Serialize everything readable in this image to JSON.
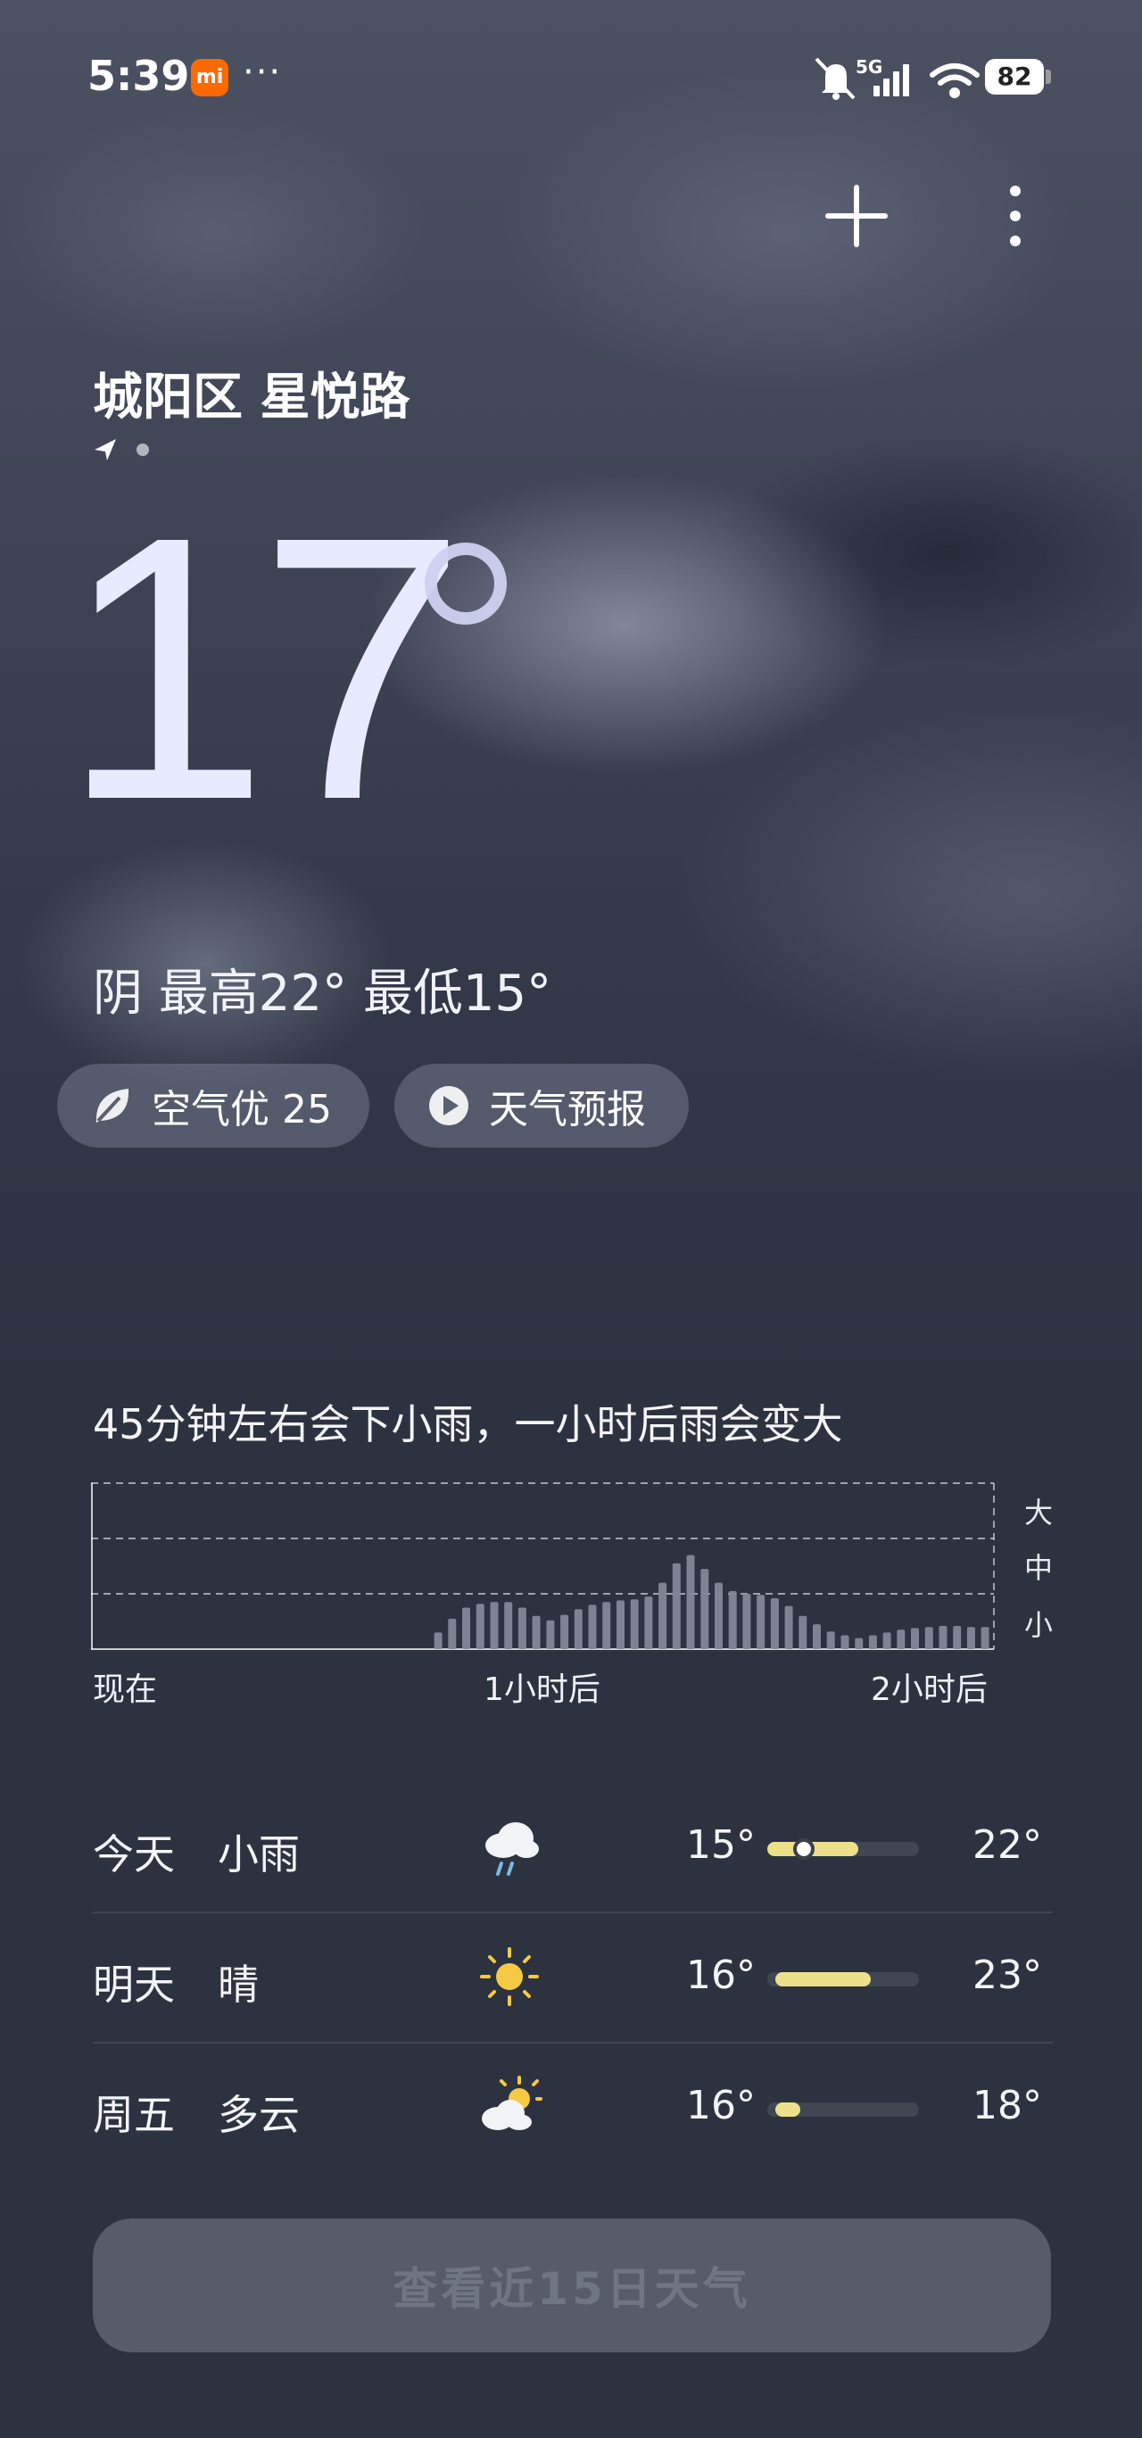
{
  "status_bar": {
    "time": "5:39",
    "mi_badge": "mi",
    "more": "···",
    "network": "5G",
    "battery": "82"
  },
  "header": {
    "add_icon": "plus-icon",
    "menu_icon": "more-vertical-icon"
  },
  "location": {
    "name": "城阳区 星悦路",
    "page_indicator": "2 pages, location page active"
  },
  "current": {
    "temperature": "17",
    "summary": "阴  最高22° 最低15°"
  },
  "chips": [
    {
      "label": "空气优 25",
      "icon": "leaf-icon"
    },
    {
      "label": "天气预报",
      "icon": "play-icon"
    }
  ],
  "rain": {
    "headline": "45分钟左右会下小雨，一小时后雨会变大",
    "x_labels": [
      "现在",
      "1小时后",
      "2小时后"
    ],
    "levels": [
      "大",
      "中",
      "小"
    ]
  },
  "chart_data": {
    "type": "bar",
    "xlabel": "",
    "ylabel": "",
    "categories": [
      "现在",
      "1小时后",
      "2小时后"
    ],
    "x_range_minutes": [
      0,
      120
    ],
    "levels": [
      "小",
      "中",
      "大"
    ],
    "ylim": [
      0,
      3
    ],
    "series": [
      {
        "values": [
          0,
          0,
          0,
          0,
          0,
          0,
          0,
          0,
          0,
          0,
          0,
          0,
          0,
          0,
          0,
          0,
          0,
          0,
          0,
          0,
          0,
          0,
          0,
          0,
          0.3,
          0.55,
          0.75,
          0.82,
          0.85,
          0.85,
          0.75,
          0.6,
          0.52,
          0.62,
          0.72,
          0.8,
          0.85,
          0.88,
          0.9,
          0.95,
          1.2,
          1.55,
          1.7,
          1.45,
          1.2,
          1.05,
          1.0,
          0.98,
          0.92,
          0.78,
          0.6,
          0.45,
          0.32,
          0.25,
          0.2,
          0.25,
          0.3,
          0.35,
          0.38,
          0.4,
          0.42,
          0.42,
          0.4,
          0.4
        ]
      }
    ],
    "grid": true
  },
  "forecast": [
    {
      "day": "今天",
      "cond": "小雨",
      "icon": "rain-cloud-icon",
      "lo": "15°",
      "hi": "22°",
      "bar_start": 0.0,
      "bar_end": 0.6,
      "now": 0.22
    },
    {
      "day": "明天",
      "cond": "晴",
      "icon": "sun-icon",
      "lo": "16°",
      "hi": "23°",
      "bar_start": 0.05,
      "bar_end": 0.68,
      "now": null
    },
    {
      "day": "周五",
      "cond": "多云",
      "icon": "partly-cloudy-icon",
      "lo": "16°",
      "hi": "18°",
      "bar_start": 0.05,
      "bar_end": 0.22,
      "now": null
    }
  ],
  "bottom_button": {
    "label": "查看近15日天气"
  }
}
